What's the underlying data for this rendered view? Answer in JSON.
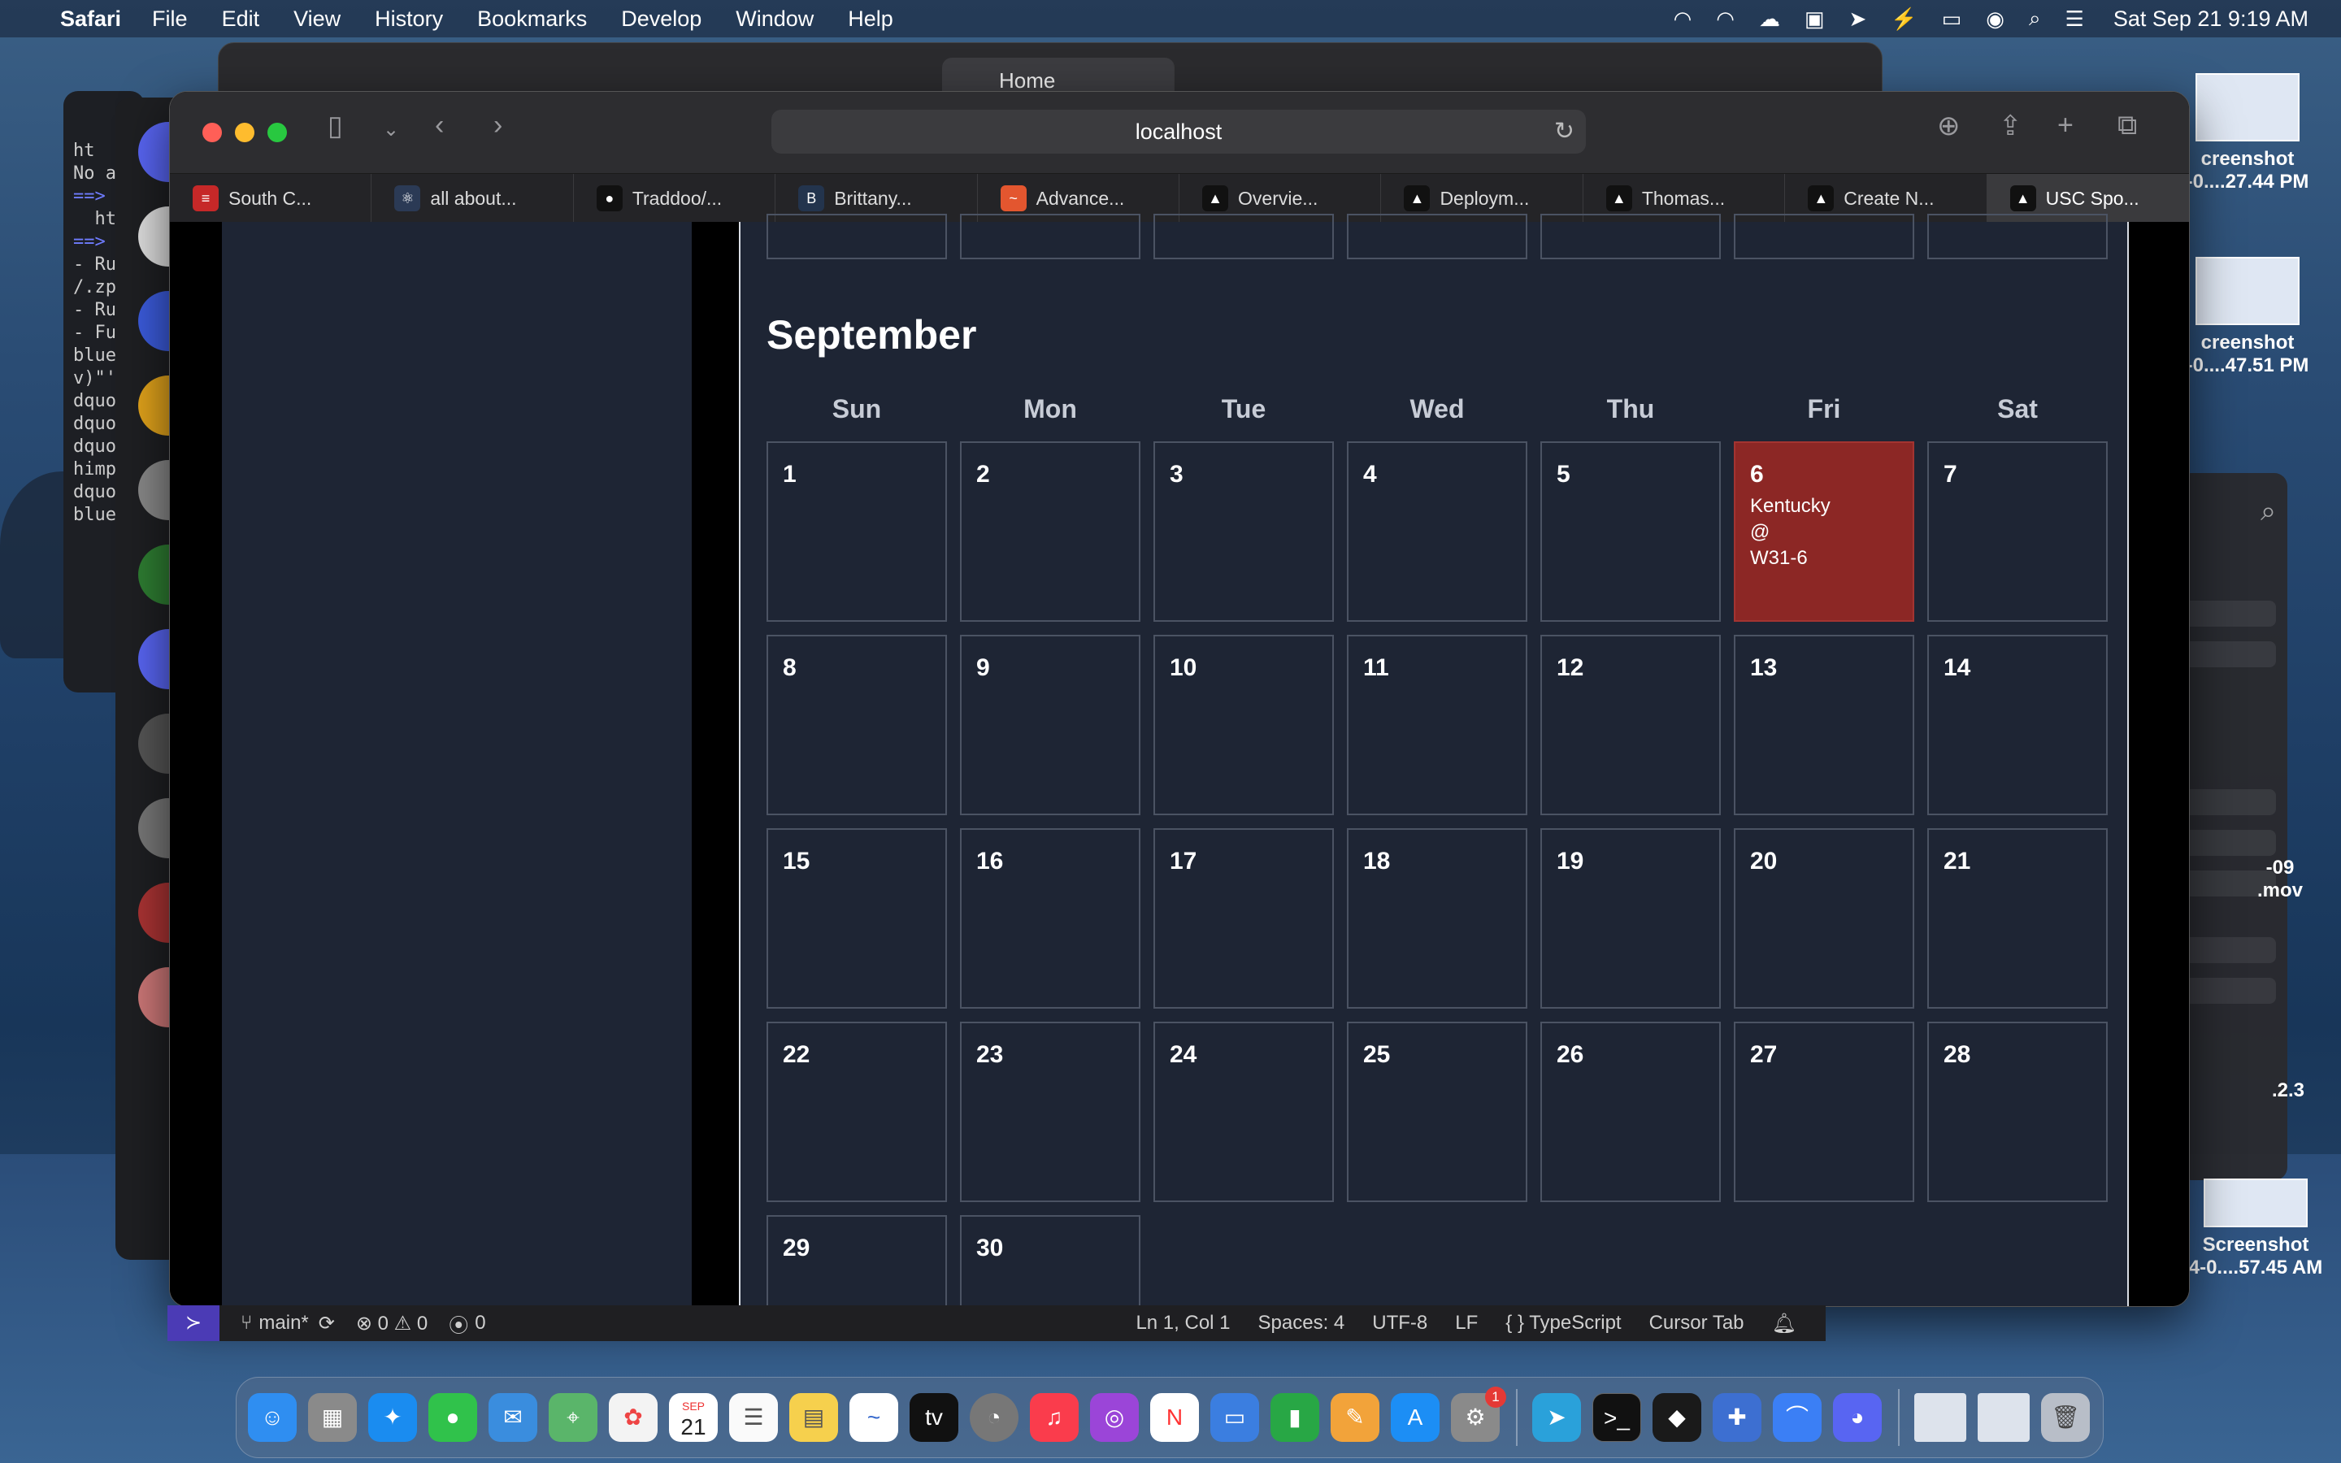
{
  "menubar": {
    "app": "Safari",
    "items": [
      "File",
      "Edit",
      "View",
      "History",
      "Bookmarks",
      "Develop",
      "Window",
      "Help"
    ],
    "clock": "Sat Sep 21  9:19 AM",
    "status_icons": [
      "wifi-icon",
      "search-icon",
      "control-center-icon",
      "battery-icon"
    ]
  },
  "terminal_bg": {
    "lines": [
      "ht",
      "No a",
      "",
      "==>",
      "  ht",
      "",
      "==>",
      "- Ru",
      "",
      "/.zp",
      "",
      "- Ru",
      "- Fu",
      "",
      "",
      "blue",
      "v)\"'",
      "",
      "dquo",
      "dquo",
      "dquo",
      "himp",
      "dquo",
      "blue"
    ]
  },
  "back_window": {
    "tab_title": "Home"
  },
  "desktop_icons": [
    {
      "line1": "creenshot",
      "line2": "-0....27.44 PM"
    },
    {
      "line1": "creenshot",
      "line2": "-0....47.51 PM"
    },
    {
      "line1": "-09",
      "line2": ".mov"
    },
    {
      "line1": ".2.3",
      "line2": ""
    },
    {
      "line1": "Screenshot",
      "line2": "4-0....57.45 AM"
    }
  ],
  "safari": {
    "url": "localhost",
    "tabs": [
      {
        "label": "South C...",
        "color": "#c62828",
        "glyph": "≡"
      },
      {
        "label": "all about...",
        "color": "#2b3a55",
        "glyph": "⚛"
      },
      {
        "label": "Traddoo/...",
        "color": "#111111",
        "glyph": "●"
      },
      {
        "label": "Brittany...",
        "color": "#23344d",
        "glyph": "B"
      },
      {
        "label": "Advance...",
        "color": "#e3562f",
        "glyph": "~"
      },
      {
        "label": "Overvie...",
        "color": "#111111",
        "glyph": "▲"
      },
      {
        "label": "Deploym...",
        "color": "#111111",
        "glyph": "▲"
      },
      {
        "label": "Thomas...",
        "color": "#111111",
        "glyph": "▲"
      },
      {
        "label": "Create N...",
        "color": "#111111",
        "glyph": "▲"
      },
      {
        "label": "USC Spo...",
        "color": "#111111",
        "glyph": "▲"
      }
    ]
  },
  "calendar": {
    "month": "September",
    "weekdays": [
      "Sun",
      "Mon",
      "Tue",
      "Wed",
      "Thu",
      "Fri",
      "Sat"
    ],
    "days": [
      "1",
      "2",
      "3",
      "4",
      "5",
      "6",
      "7",
      "8",
      "9",
      "10",
      "11",
      "12",
      "13",
      "14",
      "15",
      "16",
      "17",
      "18",
      "19",
      "20",
      "21",
      "22",
      "23",
      "24",
      "25",
      "26",
      "27",
      "28",
      "29",
      "30"
    ],
    "event": {
      "day": "6",
      "line1": "Kentucky",
      "line2": "@",
      "line3": "W31-6",
      "color": "#8c2725"
    }
  },
  "statusbar": {
    "branch": "main*",
    "problems": "⊗ 0 ⚠ 0",
    "ports": "0",
    "position": "Ln 1, Col 1",
    "spaces": "Spaces: 4",
    "encoding": "UTF-8",
    "eol": "LF",
    "language": "{ } TypeScript",
    "extra": "Cursor Tab"
  },
  "dock": {
    "date_day": "21",
    "date_month": "SEP",
    "settings_badge": "1"
  }
}
